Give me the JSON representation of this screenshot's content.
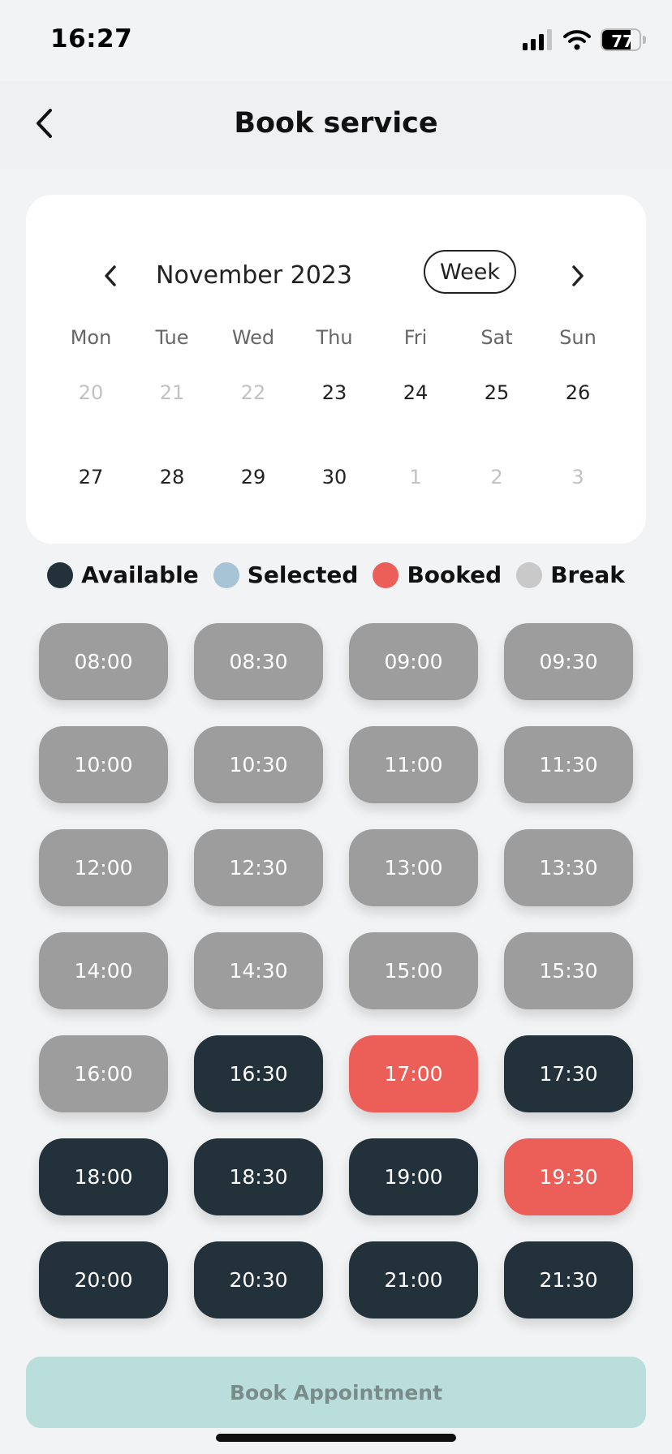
{
  "status_bar": {
    "time": "16:27",
    "battery": "77",
    "battery_level": 0.77
  },
  "header": {
    "title": "Book service"
  },
  "calendar": {
    "month_label": "November 2023",
    "view_toggle": "Week",
    "weekdays": [
      "Mon",
      "Tue",
      "Wed",
      "Thu",
      "Fri",
      "Sat",
      "Sun"
    ],
    "weeks": [
      [
        {
          "day": "20",
          "muted": true
        },
        {
          "day": "21",
          "muted": true
        },
        {
          "day": "22",
          "muted": true
        },
        {
          "day": "23",
          "muted": false
        },
        {
          "day": "24",
          "muted": false
        },
        {
          "day": "25",
          "muted": false
        },
        {
          "day": "26",
          "muted": false
        }
      ],
      [
        {
          "day": "27",
          "muted": false
        },
        {
          "day": "28",
          "muted": false
        },
        {
          "day": "29",
          "muted": false
        },
        {
          "day": "30",
          "muted": false
        },
        {
          "day": "1",
          "muted": true
        },
        {
          "day": "2",
          "muted": true
        },
        {
          "day": "3",
          "muted": true
        }
      ]
    ]
  },
  "legend": [
    {
      "label": "Available",
      "color": "#23313a"
    },
    {
      "label": "Selected",
      "color": "#a7c4d6"
    },
    {
      "label": "Booked",
      "color": "#ec5f59"
    },
    {
      "label": "Break",
      "color": "#c9c9c9"
    }
  ],
  "colors": {
    "available": "#23313a",
    "booked": "#ec5f59",
    "break": "#9d9d9d",
    "book_button_bg": "#b9dedb",
    "book_button_text": "#7a8c8a"
  },
  "slots": [
    {
      "time": "08:00",
      "status": "break"
    },
    {
      "time": "08:30",
      "status": "break"
    },
    {
      "time": "09:00",
      "status": "break"
    },
    {
      "time": "09:30",
      "status": "break"
    },
    {
      "time": "10:00",
      "status": "break"
    },
    {
      "time": "10:30",
      "status": "break"
    },
    {
      "time": "11:00",
      "status": "break"
    },
    {
      "time": "11:30",
      "status": "break"
    },
    {
      "time": "12:00",
      "status": "break"
    },
    {
      "time": "12:30",
      "status": "break"
    },
    {
      "time": "13:00",
      "status": "break"
    },
    {
      "time": "13:30",
      "status": "break"
    },
    {
      "time": "14:00",
      "status": "break"
    },
    {
      "time": "14:30",
      "status": "break"
    },
    {
      "time": "15:00",
      "status": "break"
    },
    {
      "time": "15:30",
      "status": "break"
    },
    {
      "time": "16:00",
      "status": "break"
    },
    {
      "time": "16:30",
      "status": "available"
    },
    {
      "time": "17:00",
      "status": "booked"
    },
    {
      "time": "17:30",
      "status": "available"
    },
    {
      "time": "18:00",
      "status": "available"
    },
    {
      "time": "18:30",
      "status": "available"
    },
    {
      "time": "19:00",
      "status": "available"
    },
    {
      "time": "19:30",
      "status": "booked"
    },
    {
      "time": "20:00",
      "status": "available"
    },
    {
      "time": "20:30",
      "status": "available"
    },
    {
      "time": "21:00",
      "status": "available"
    },
    {
      "time": "21:30",
      "status": "available"
    }
  ],
  "book_button": {
    "label": "Book Appointment"
  }
}
